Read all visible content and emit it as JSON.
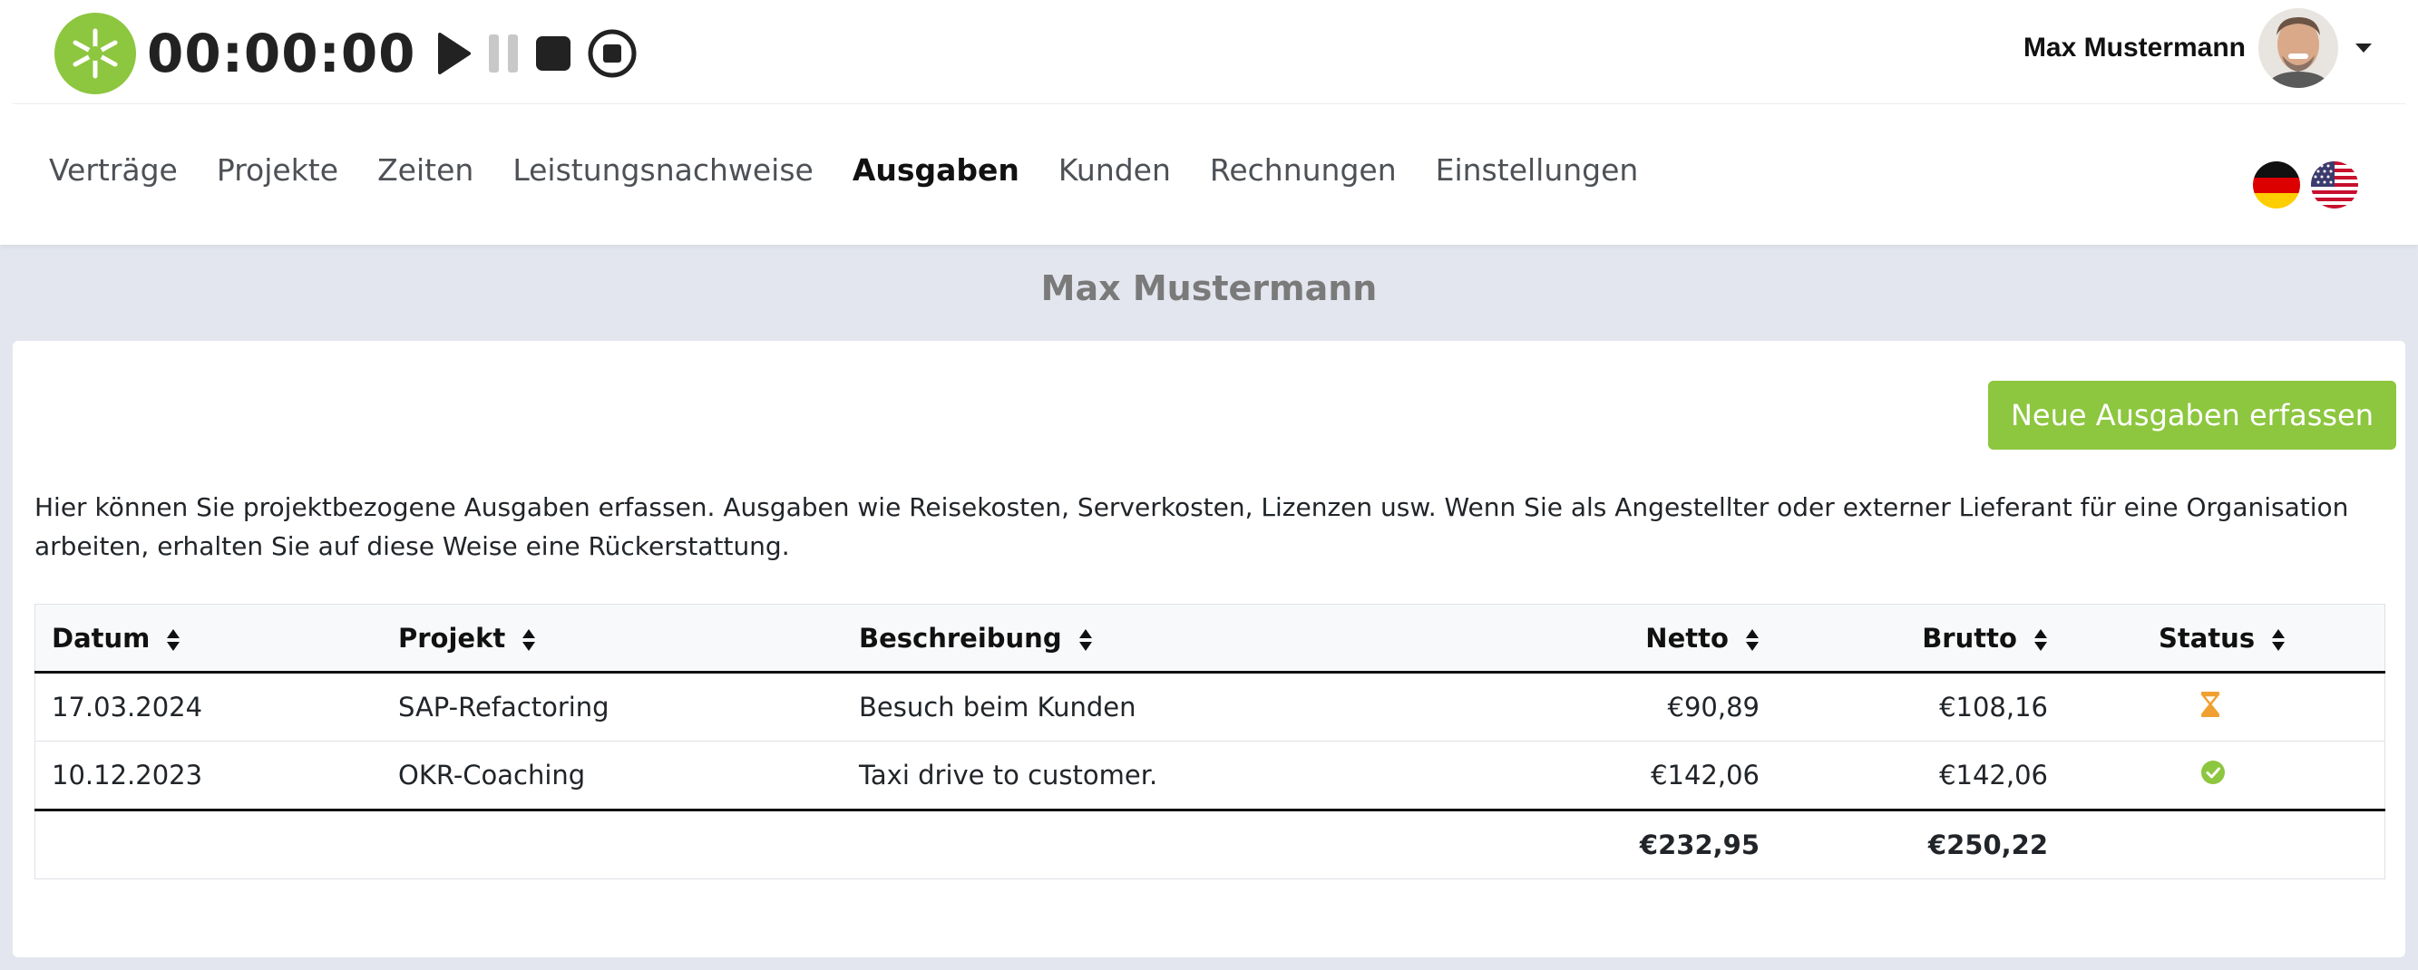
{
  "timer": {
    "display": "00:00:00",
    "icons": [
      "play-icon",
      "pause-icon",
      "stop-icon",
      "record-stop-icon"
    ]
  },
  "user": {
    "name": "Max Mustermann"
  },
  "nav": {
    "items": [
      {
        "label": "Verträge"
      },
      {
        "label": "Projekte"
      },
      {
        "label": "Zeiten"
      },
      {
        "label": "Leistungsnachweise"
      },
      {
        "label": "Ausgaben"
      },
      {
        "label": "Kunden"
      },
      {
        "label": "Rechnungen"
      },
      {
        "label": "Einstellungen"
      }
    ],
    "active": "Ausgaben"
  },
  "languages": [
    "german-flag-icon",
    "us-flag-icon"
  ],
  "page": {
    "title": "Max Mustermann",
    "new_button_label": "Neue Ausgaben erfassen",
    "intro": "Hier können Sie projektbezogene Ausgaben erfassen. Ausgaben wie Reisekosten, Serverkosten, Lizenzen usw. Wenn Sie als Angestellter oder externer Lieferant für eine Organisation arbeiten, erhalten Sie auf diese Weise eine Rückerstattung."
  },
  "table": {
    "headers": {
      "datum": "Datum",
      "projekt": "Projekt",
      "beschreibung": "Beschreibung",
      "netto": "Netto",
      "brutto": "Brutto",
      "status": "Status"
    },
    "rows": [
      {
        "datum": "17.03.2024",
        "projekt": "SAP-Refactoring",
        "beschreibung": "Besuch beim Kunden",
        "netto": "€90,89",
        "brutto": "€108,16",
        "status": "hourglass-icon"
      },
      {
        "datum": "10.12.2023",
        "projekt": "OKR-Coaching",
        "beschreibung": "Taxi drive to customer.",
        "netto": "€142,06",
        "brutto": "€142,06",
        "status": "check-circle-icon"
      }
    ],
    "totals": {
      "netto": "€232,95",
      "brutto": "€250,22"
    }
  },
  "colors": {
    "accent": "#8dc63f",
    "pending": "#f0a030",
    "approved": "#8dc63f"
  }
}
